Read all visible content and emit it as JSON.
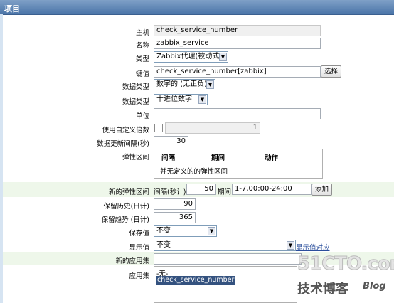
{
  "header": {
    "title": "项目"
  },
  "host": {
    "label": "主机",
    "value": "check_service_number"
  },
  "name": {
    "label": "名称",
    "value": "zabbix_service"
  },
  "type": {
    "label": "类型",
    "value": "Zabbix代理(被动式)"
  },
  "key": {
    "label": "键值",
    "value": "check_service_number[zabbix]",
    "button": "选择"
  },
  "data_type": {
    "label": "数据类型",
    "value": "数字的 (无正负)"
  },
  "data_format": {
    "label": "数据类型",
    "value": "十进位数字"
  },
  "units": {
    "label": "单位",
    "value": ""
  },
  "multiplier": {
    "label": "使用自定义倍数",
    "checked": false,
    "value": "1"
  },
  "interval": {
    "label": "数据更新间隔(秒)",
    "value": "30"
  },
  "flex": {
    "label": "弹性区间",
    "columns": [
      "间隔",
      "期间",
      "动作"
    ],
    "empty_text": "并无定义的的弹性区间"
  },
  "new_flex": {
    "label": "新的弹性区间",
    "interval_label": "间隔(秒计)",
    "interval_value": "50",
    "period_label": "期间",
    "period_value": "1-7,00:00-24:00",
    "add_button": "添加"
  },
  "history": {
    "label": "保留历史(日计)",
    "value": "90"
  },
  "trends": {
    "label": "保留趋势 (日计)",
    "value": "365"
  },
  "store_value": {
    "label": "保存值",
    "value": "不变"
  },
  "show_value": {
    "label": "显示值",
    "value": "不变",
    "link": "显示值对应"
  },
  "new_app": {
    "label": "新的应用集",
    "value": ""
  },
  "applications": {
    "label": "应用集",
    "items": [
      "-无-",
      "check_service_number"
    ],
    "selected_index": 1
  },
  "watermark": {
    "site": "51CTO.com",
    "sub": "技术博客",
    "blog": "Blog"
  }
}
